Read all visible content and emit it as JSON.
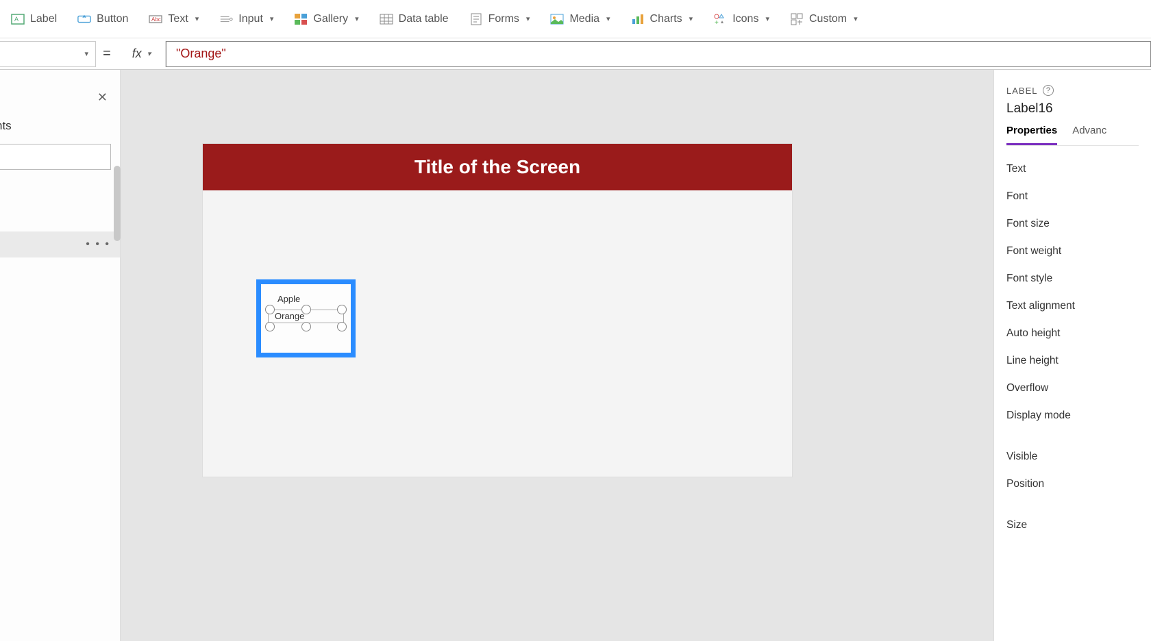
{
  "ribbon": {
    "label": "Label",
    "button": "Button",
    "text": "Text",
    "input": "Input",
    "gallery": "Gallery",
    "datatable": "Data table",
    "forms": "Forms",
    "media": "Media",
    "charts": "Charts",
    "icons": "Icons",
    "custom": "Custom"
  },
  "formula": {
    "eq": "=",
    "fx": "fx",
    "value": "\"Orange\""
  },
  "leftPane": {
    "heading_partial": "nts",
    "more": "• • •"
  },
  "canvas": {
    "title": "Title of the Screen",
    "item1": "Apple",
    "item2": "Orange"
  },
  "props": {
    "header": "LABEL",
    "controlName": "Label16",
    "tabs": {
      "properties": "Properties",
      "advanced": "Advanc"
    },
    "items": [
      "Text",
      "Font",
      "Font size",
      "Font weight",
      "Font style",
      "Text alignment",
      "Auto height",
      "Line height",
      "Overflow",
      "Display mode"
    ],
    "items2": [
      "Visible",
      "Position"
    ],
    "items3": [
      "Size"
    ]
  }
}
